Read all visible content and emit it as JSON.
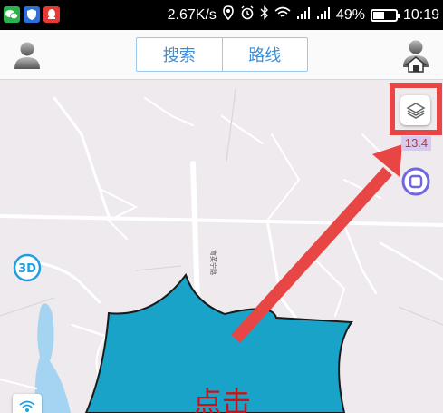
{
  "status_bar": {
    "speed": "2.67K/s",
    "battery": "49%",
    "battery_level_percent": 49,
    "time": "10:19",
    "icons": [
      "wechat-icon",
      "shield-app-icon",
      "qq-icon",
      "location-icon",
      "alarm-icon",
      "bluetooth-icon",
      "wifi-icon",
      "signal-icon",
      "signal-icon-2",
      "battery-icon"
    ]
  },
  "header": {
    "tabs": [
      {
        "label": "搜索"
      },
      {
        "label": "路线"
      }
    ],
    "left_icon": "user-avatar-icon",
    "right_icon": "user-home-icon"
  },
  "map": {
    "zoom_level": "13.4",
    "road_label": "育英宁路",
    "layer_icon": "layers-icon",
    "threed_label": "3D",
    "colors": {
      "background": "#efeaed",
      "road": "#ffffff",
      "water": "#a5d4f2",
      "highlight": "#e84545",
      "callout": "#1aa3c9"
    }
  },
  "callout": {
    "text": "点击"
  }
}
